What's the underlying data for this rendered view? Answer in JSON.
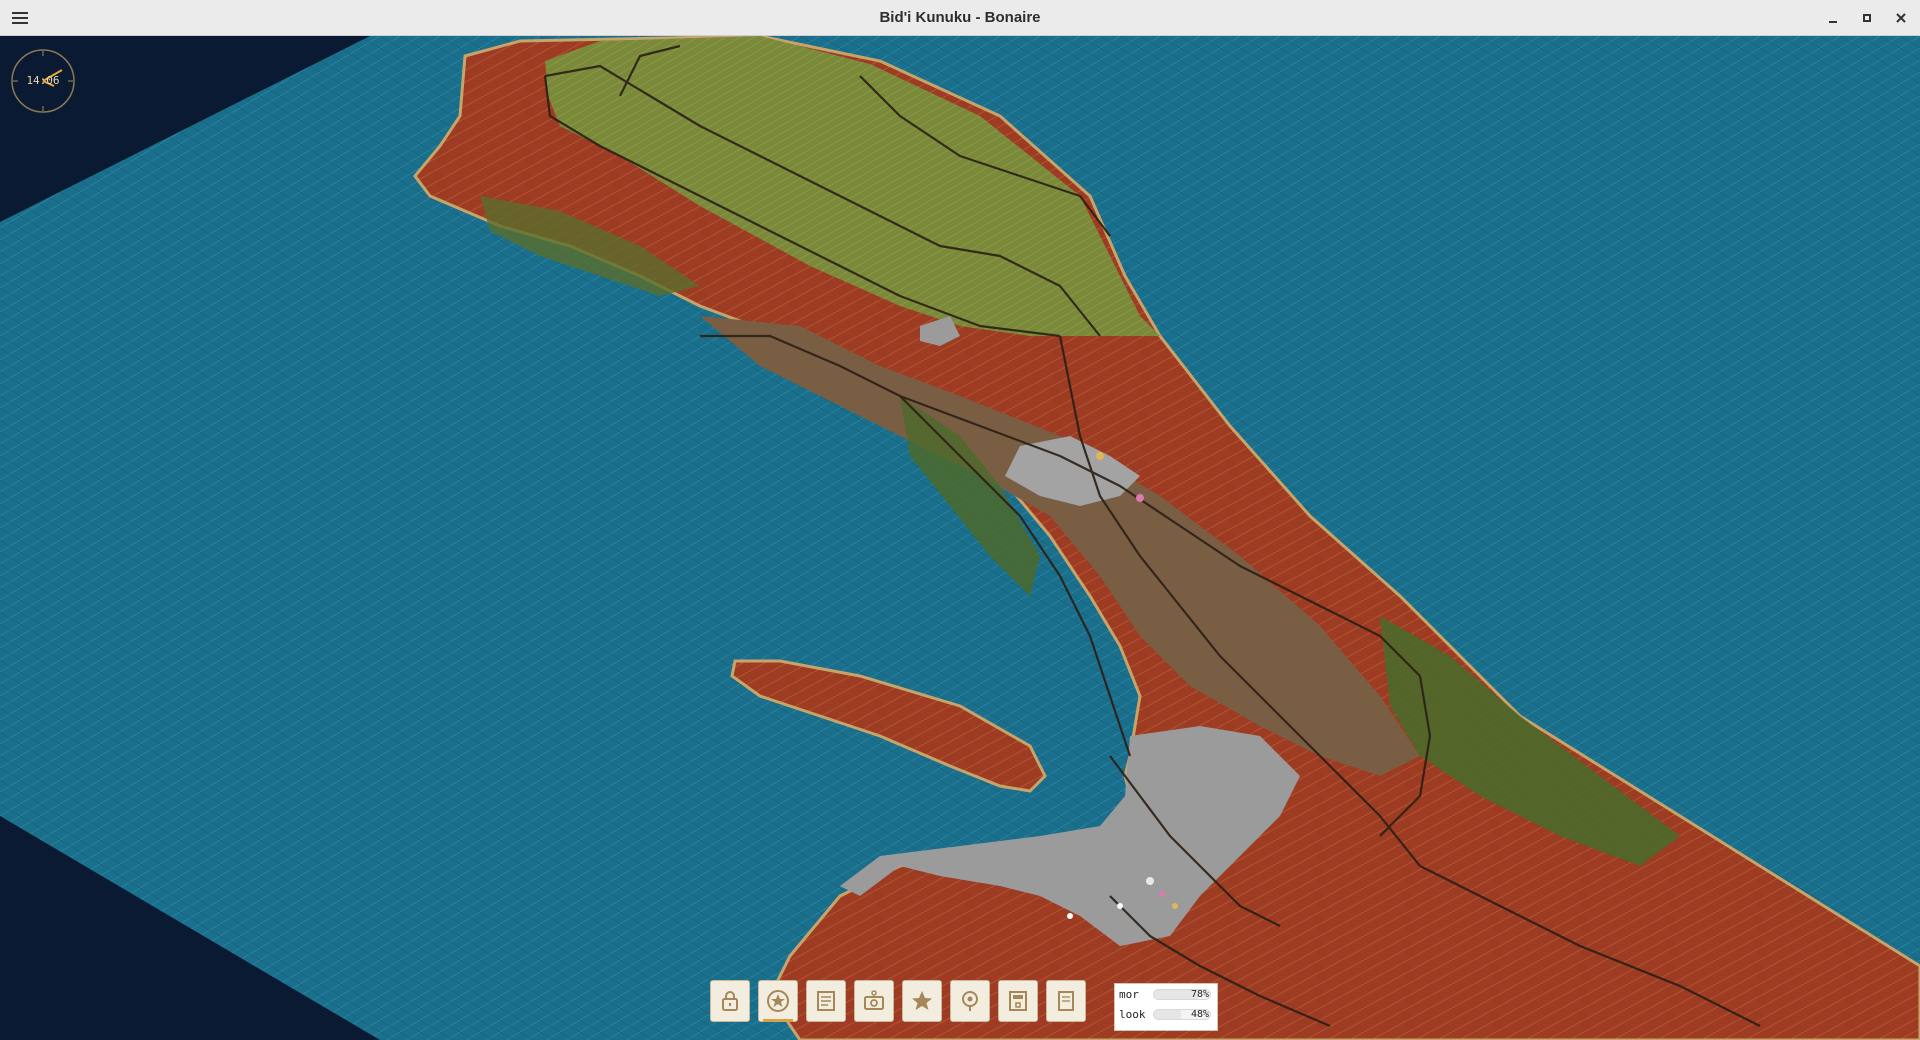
{
  "window": {
    "title": "Bid'i Kunuku - Bonaire",
    "menu_icon": "hamburger-icon",
    "minimize_icon": "minimize-icon",
    "maximize_icon": "maximize-icon",
    "close_icon": "close-icon"
  },
  "clock": {
    "time": "14:06"
  },
  "colors": {
    "background": "#0b1a33",
    "water": "#1a6f8c",
    "land_red": "#9d3b23",
    "land_brown": "#7a5e44",
    "land_green": "#4d6a2b",
    "hills_olive": "#7a8a3a",
    "urban_grey": "#9b9b9b",
    "accent": "#d7a247"
  },
  "toolbar": {
    "buttons": [
      {
        "icon": "lock-icon",
        "active": false
      },
      {
        "icon": "star-badge-icon",
        "active": true
      },
      {
        "icon": "document-icon",
        "active": false
      },
      {
        "icon": "camera-icon",
        "active": false
      },
      {
        "icon": "star-icon",
        "active": false
      },
      {
        "icon": "location-pin-icon",
        "active": false
      },
      {
        "icon": "calculator-icon",
        "active": false
      },
      {
        "icon": "notes-icon",
        "active": false
      }
    ]
  },
  "stats": [
    {
      "label": "mor",
      "value": "78%",
      "level": 0.78
    },
    {
      "label": "look",
      "value": "48%",
      "level": 0.48
    }
  ]
}
